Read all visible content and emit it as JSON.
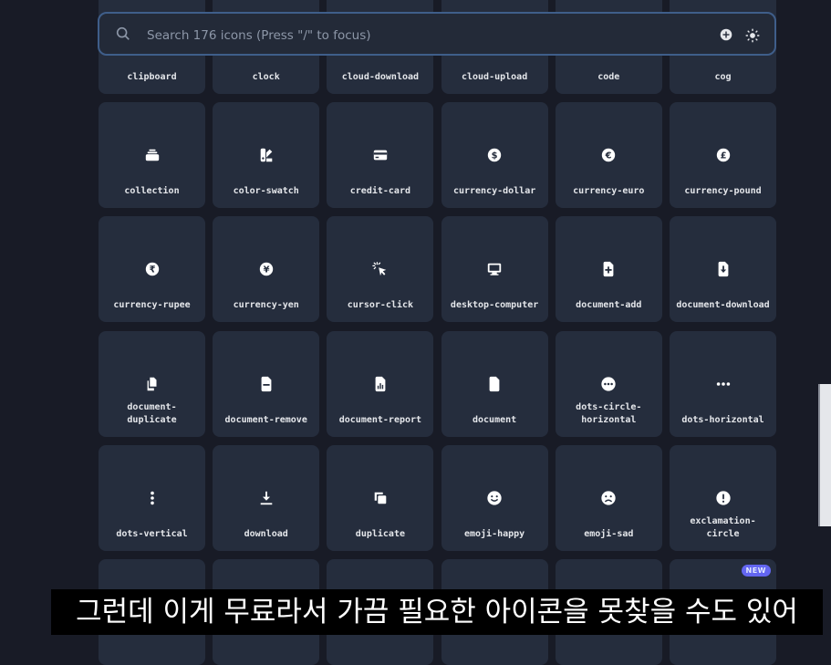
{
  "search": {
    "placeholder": "Search 176 icons (Press \"/\" to focus)"
  },
  "icons": [
    {
      "label": "clipboard",
      "icon": "clipboard-icon"
    },
    {
      "label": "clock",
      "icon": "clock-icon"
    },
    {
      "label": "cloud-download",
      "icon": "cloud-download-icon"
    },
    {
      "label": "cloud-upload",
      "icon": "cloud-upload-icon"
    },
    {
      "label": "code",
      "icon": "code-icon"
    },
    {
      "label": "cog",
      "icon": "cog-icon"
    },
    {
      "label": "collection",
      "icon": "collection-icon"
    },
    {
      "label": "color-swatch",
      "icon": "color-swatch-icon"
    },
    {
      "label": "credit-card",
      "icon": "credit-card-icon"
    },
    {
      "label": "currency-dollar",
      "icon": "currency-dollar-icon"
    },
    {
      "label": "currency-euro",
      "icon": "currency-euro-icon"
    },
    {
      "label": "currency-pound",
      "icon": "currency-pound-icon"
    },
    {
      "label": "currency-rupee",
      "icon": "currency-rupee-icon"
    },
    {
      "label": "currency-yen",
      "icon": "currency-yen-icon"
    },
    {
      "label": "cursor-click",
      "icon": "cursor-click-icon"
    },
    {
      "label": "desktop-computer",
      "icon": "desktop-computer-icon"
    },
    {
      "label": "document-add",
      "icon": "document-add-icon"
    },
    {
      "label": "document-download",
      "icon": "document-download-icon"
    },
    {
      "label": "document-\nduplicate",
      "icon": "document-duplicate-icon"
    },
    {
      "label": "document-remove",
      "icon": "document-remove-icon"
    },
    {
      "label": "document-report",
      "icon": "document-report-icon"
    },
    {
      "label": "document",
      "icon": "document-icon"
    },
    {
      "label": "dots-circle-\nhorizontal",
      "icon": "dots-circle-horizontal-icon"
    },
    {
      "label": "dots-horizontal",
      "icon": "dots-horizontal-icon"
    },
    {
      "label": "dots-vertical",
      "icon": "dots-vertical-icon"
    },
    {
      "label": "download",
      "icon": "download-icon"
    },
    {
      "label": "duplicate",
      "icon": "duplicate-icon"
    },
    {
      "label": "emoji-happy",
      "icon": "emoji-happy-icon"
    },
    {
      "label": "emoji-sad",
      "icon": "emoji-sad-icon"
    },
    {
      "label": "exclamation-\ncircle",
      "icon": "exclamation-circle-icon"
    },
    {
      "label": "",
      "icon": ""
    },
    {
      "label": "",
      "icon": ""
    },
    {
      "label": "",
      "icon": ""
    },
    {
      "label": "",
      "icon": ""
    },
    {
      "label": "",
      "icon": ""
    },
    {
      "label": "",
      "icon": "",
      "badge": "NEW"
    }
  ],
  "caption": "그런데 이게 무료라서 가끔 필요한 아이콘을 못찾을 수도 있어",
  "colors": {
    "background": "#181b26",
    "card": "#252d3d",
    "search_border": "#3f5e8a",
    "badge": "#6366f1"
  }
}
